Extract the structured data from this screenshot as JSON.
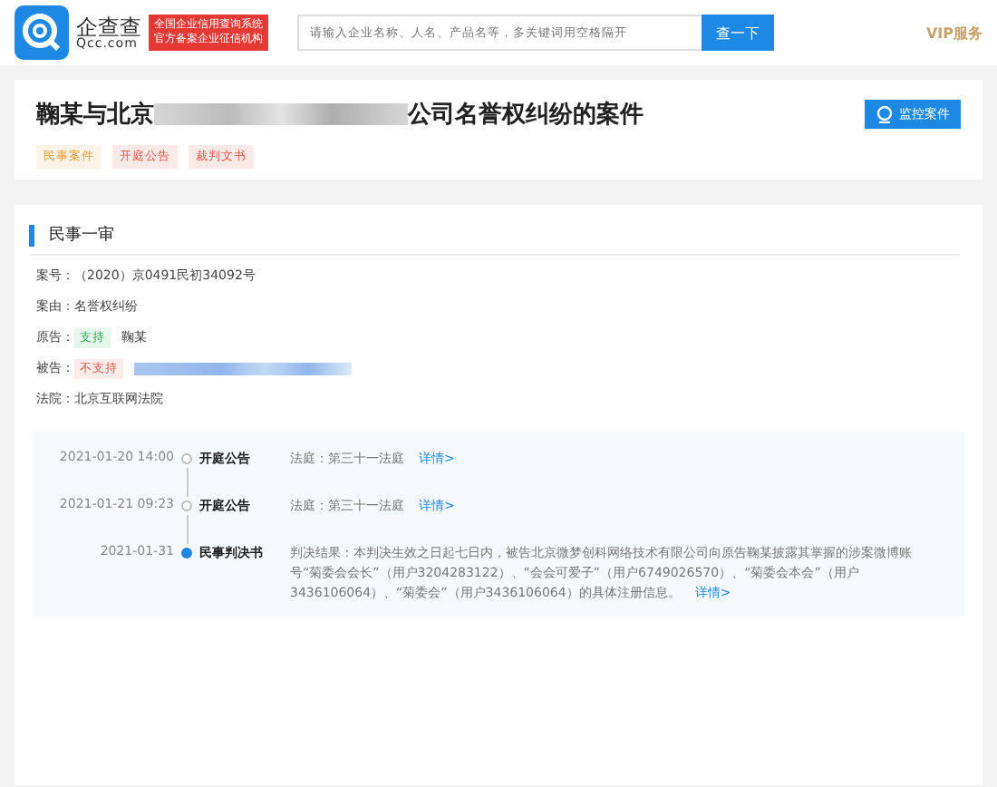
{
  "header": {
    "logo_name": "企查查",
    "logo_domain": "Qcc.com",
    "badge_lines": [
      "全国企业信用查询系统",
      "官方备案企业征信机构"
    ],
    "search": {
      "placeholder": "请输入企业名称、人名、产品名等，多关键词用空格隔开"
    },
    "search_button": "查一下",
    "vip": "VIP服务"
  },
  "case": {
    "title_start": "鞠某与北京",
    "title_end": "公司名誉权纠纷的案件",
    "monitor_button": "监控案件",
    "tags": [
      {
        "label": "民事案件",
        "color": "#f39c3c"
      },
      {
        "label": "开庭公告",
        "color": "#e8564b"
      },
      {
        "label": "裁判文书",
        "color": "#e8564b"
      }
    ]
  },
  "section": {
    "title": "民事一审",
    "fields": [
      {
        "label": "案号：",
        "value": "（2020）京0491民初34092号"
      },
      {
        "label": "案由：",
        "value": "名誉权纠纷"
      },
      {
        "label": "原告：",
        "badge": "支持",
        "kind": "support",
        "value": "鞠某"
      },
      {
        "label": "被告：",
        "badge": "不支持",
        "kind": "oppose",
        "redacted": true
      },
      {
        "label": "法院：",
        "value": "北京互联网法院"
      }
    ],
    "timeline": [
      {
        "date": "2021-01-20 14:00",
        "title": "开庭公告",
        "text": "法庭：第三十一法庭",
        "link": "详情>",
        "current": false
      },
      {
        "date": "2021-01-21 09:23",
        "title": "开庭公告",
        "text": "法庭：第三十一法庭",
        "link": "详情>",
        "current": false
      },
      {
        "date": "2021-01-31",
        "title": "民事判决书",
        "text": "判决结果：本判决生效之日起七日内，被告北京微梦创科网络技术有限公司向原告鞠某披露其掌握的涉案微博账号“菊委会会长”（用户3204283122）、“会会可爱子”（用户6749026570）、“菊委会本会”（用户3436106064）、“菊委会”（用户3436106064）的具体注册信息。",
        "link": "详情>",
        "current": true
      }
    ]
  }
}
